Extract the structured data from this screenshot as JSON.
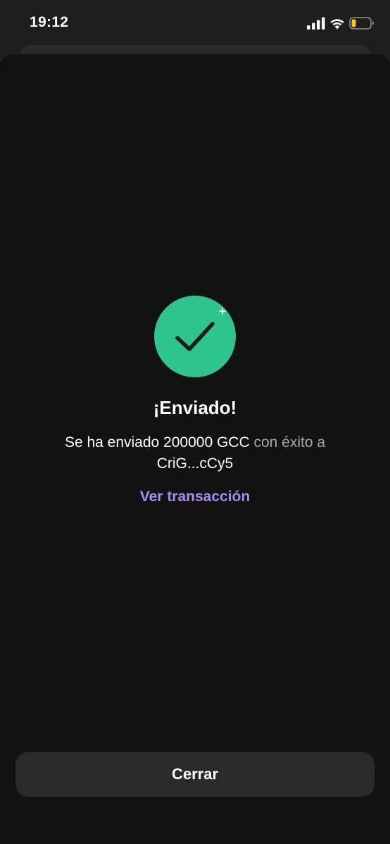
{
  "status_bar": {
    "time": "19:12",
    "icons": [
      "signal-icon",
      "wifi-icon",
      "battery-icon"
    ],
    "battery_level": 0.2,
    "battery_color": "#f5c518"
  },
  "result": {
    "icon": "checkmark-icon",
    "icon_color": "#2ec48c",
    "title": "¡Enviado!",
    "message_part1": "Se ha enviado 200000 GCC",
    "message_part2": "con éxito a",
    "message_part3": "CriG...cCy5",
    "link_label": "Ver transacción",
    "link_color": "#a48af5"
  },
  "footer": {
    "close_label": "Cerrar"
  }
}
